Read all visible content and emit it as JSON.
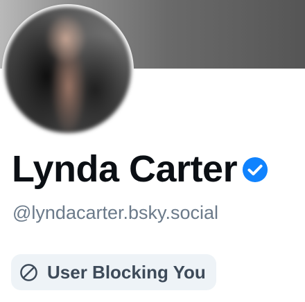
{
  "profile": {
    "display_name": "Lynda Carter",
    "handle": "@lyndacarter.bsky.social",
    "verified": true
  },
  "status": {
    "label": "User Blocking You",
    "icon": "block-icon"
  },
  "colors": {
    "verified_badge": "#1083fe",
    "name_text": "#0b0f14",
    "handle_text": "#6b7a8a",
    "badge_background": "#eef3f7",
    "badge_text": "#3d4a59"
  }
}
